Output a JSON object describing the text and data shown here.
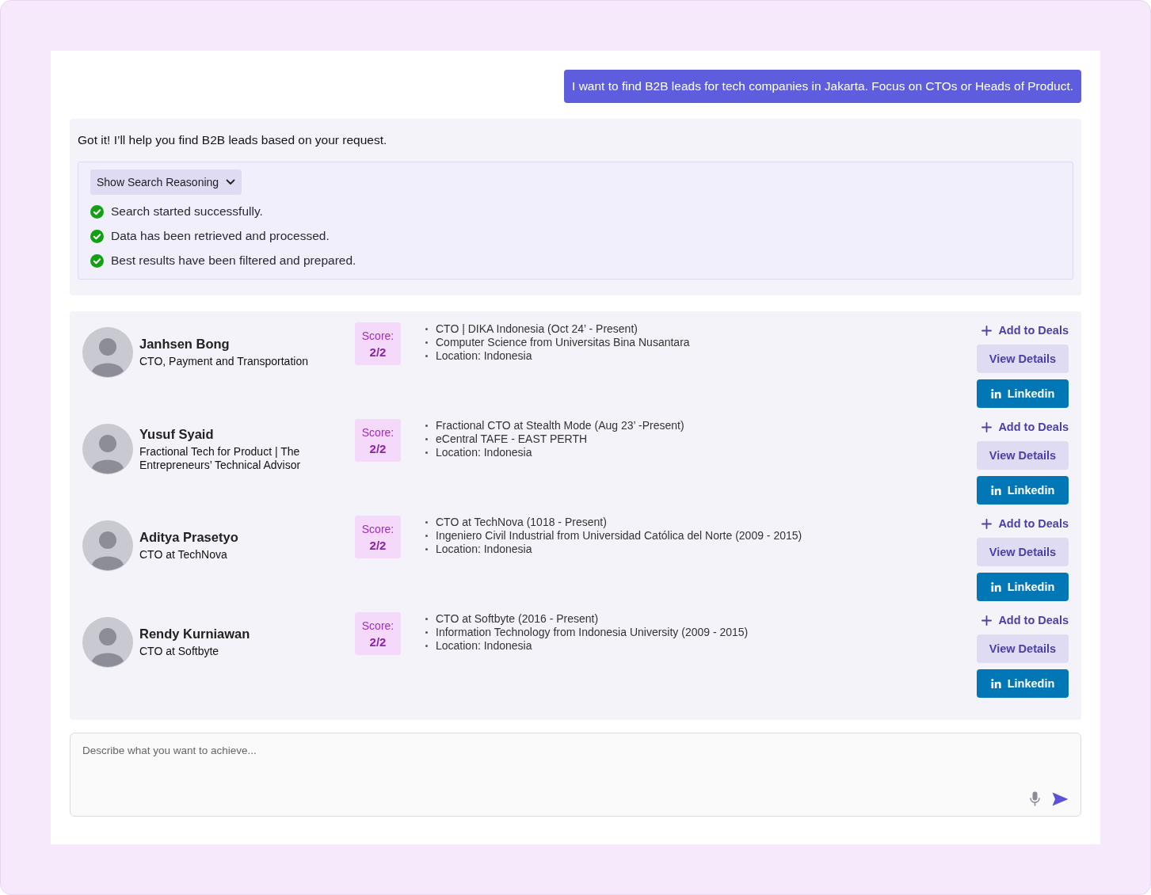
{
  "user_message": "I want to find B2B leads for tech companies in Jakarta. Focus on CTOs or Heads of Product.",
  "assistant": {
    "intro": "Got it! I’ll help you find B2B leads based on your request.",
    "reasoning": {
      "toggle_label": "Show Search Reasoning",
      "expanded": true,
      "steps": [
        {
          "text": "Search started successfully.",
          "done": true
        },
        {
          "text": "Data has been retrieved and processed.",
          "done": true
        },
        {
          "text": "Best results have been filtered and prepared.",
          "done": true
        }
      ]
    }
  },
  "leads": [
    {
      "name": "Janhsen Bong",
      "title": "CTO, Payment and Transportation",
      "score_label": "Score:",
      "score": "2/2",
      "details": [
        "CTO | DIKA Indonesia (Oct 24’ - Present)",
        "Computer Science from Universitas Bina Nusantara",
        "Location: Indonesia"
      ],
      "add_label": "Add to Deals",
      "view_label": "View Details",
      "linkedin_label": "Linkedin"
    },
    {
      "name": "Yusuf Syaid",
      "title": "Fractional Tech for Product | The Entrepreneurs’ Technical Advisor",
      "score_label": "Score:",
      "score": "2/2",
      "details": [
        "Fractional CTO at Stealth Mode (Aug 23’ -Present)",
        "eCentral TAFE - EAST PERTH",
        "Location: Indonesia"
      ],
      "add_label": "Add to Deals",
      "view_label": "View Details",
      "linkedin_label": "Linkedin"
    },
    {
      "name": "Aditya Prasetyo",
      "title": "CTO at TechNova",
      "score_label": "Score:",
      "score": "2/2",
      "details": [
        "CTO at TechNova (1018 - Present)",
        "Ingeniero Civil Industrial from Universidad Católica del Norte (2009 - 2015)",
        "Location: Indonesia"
      ],
      "add_label": "Add to Deals",
      "view_label": "View Details",
      "linkedin_label": "Linkedin"
    },
    {
      "name": "Rendy Kurniawan",
      "title": "CTO at Softbyte",
      "score_label": "Score:",
      "score": "2/2",
      "details": [
        "CTO at Softbyte (2016 - Present)",
        "Information Technology from Indonesia University (2009 - 2015)",
        "Location: Indonesia"
      ],
      "add_label": "Add to Deals",
      "view_label": "View Details",
      "linkedin_label": "Linkedin"
    }
  ],
  "composer": {
    "placeholder": "Describe what you want to achieve..."
  }
}
